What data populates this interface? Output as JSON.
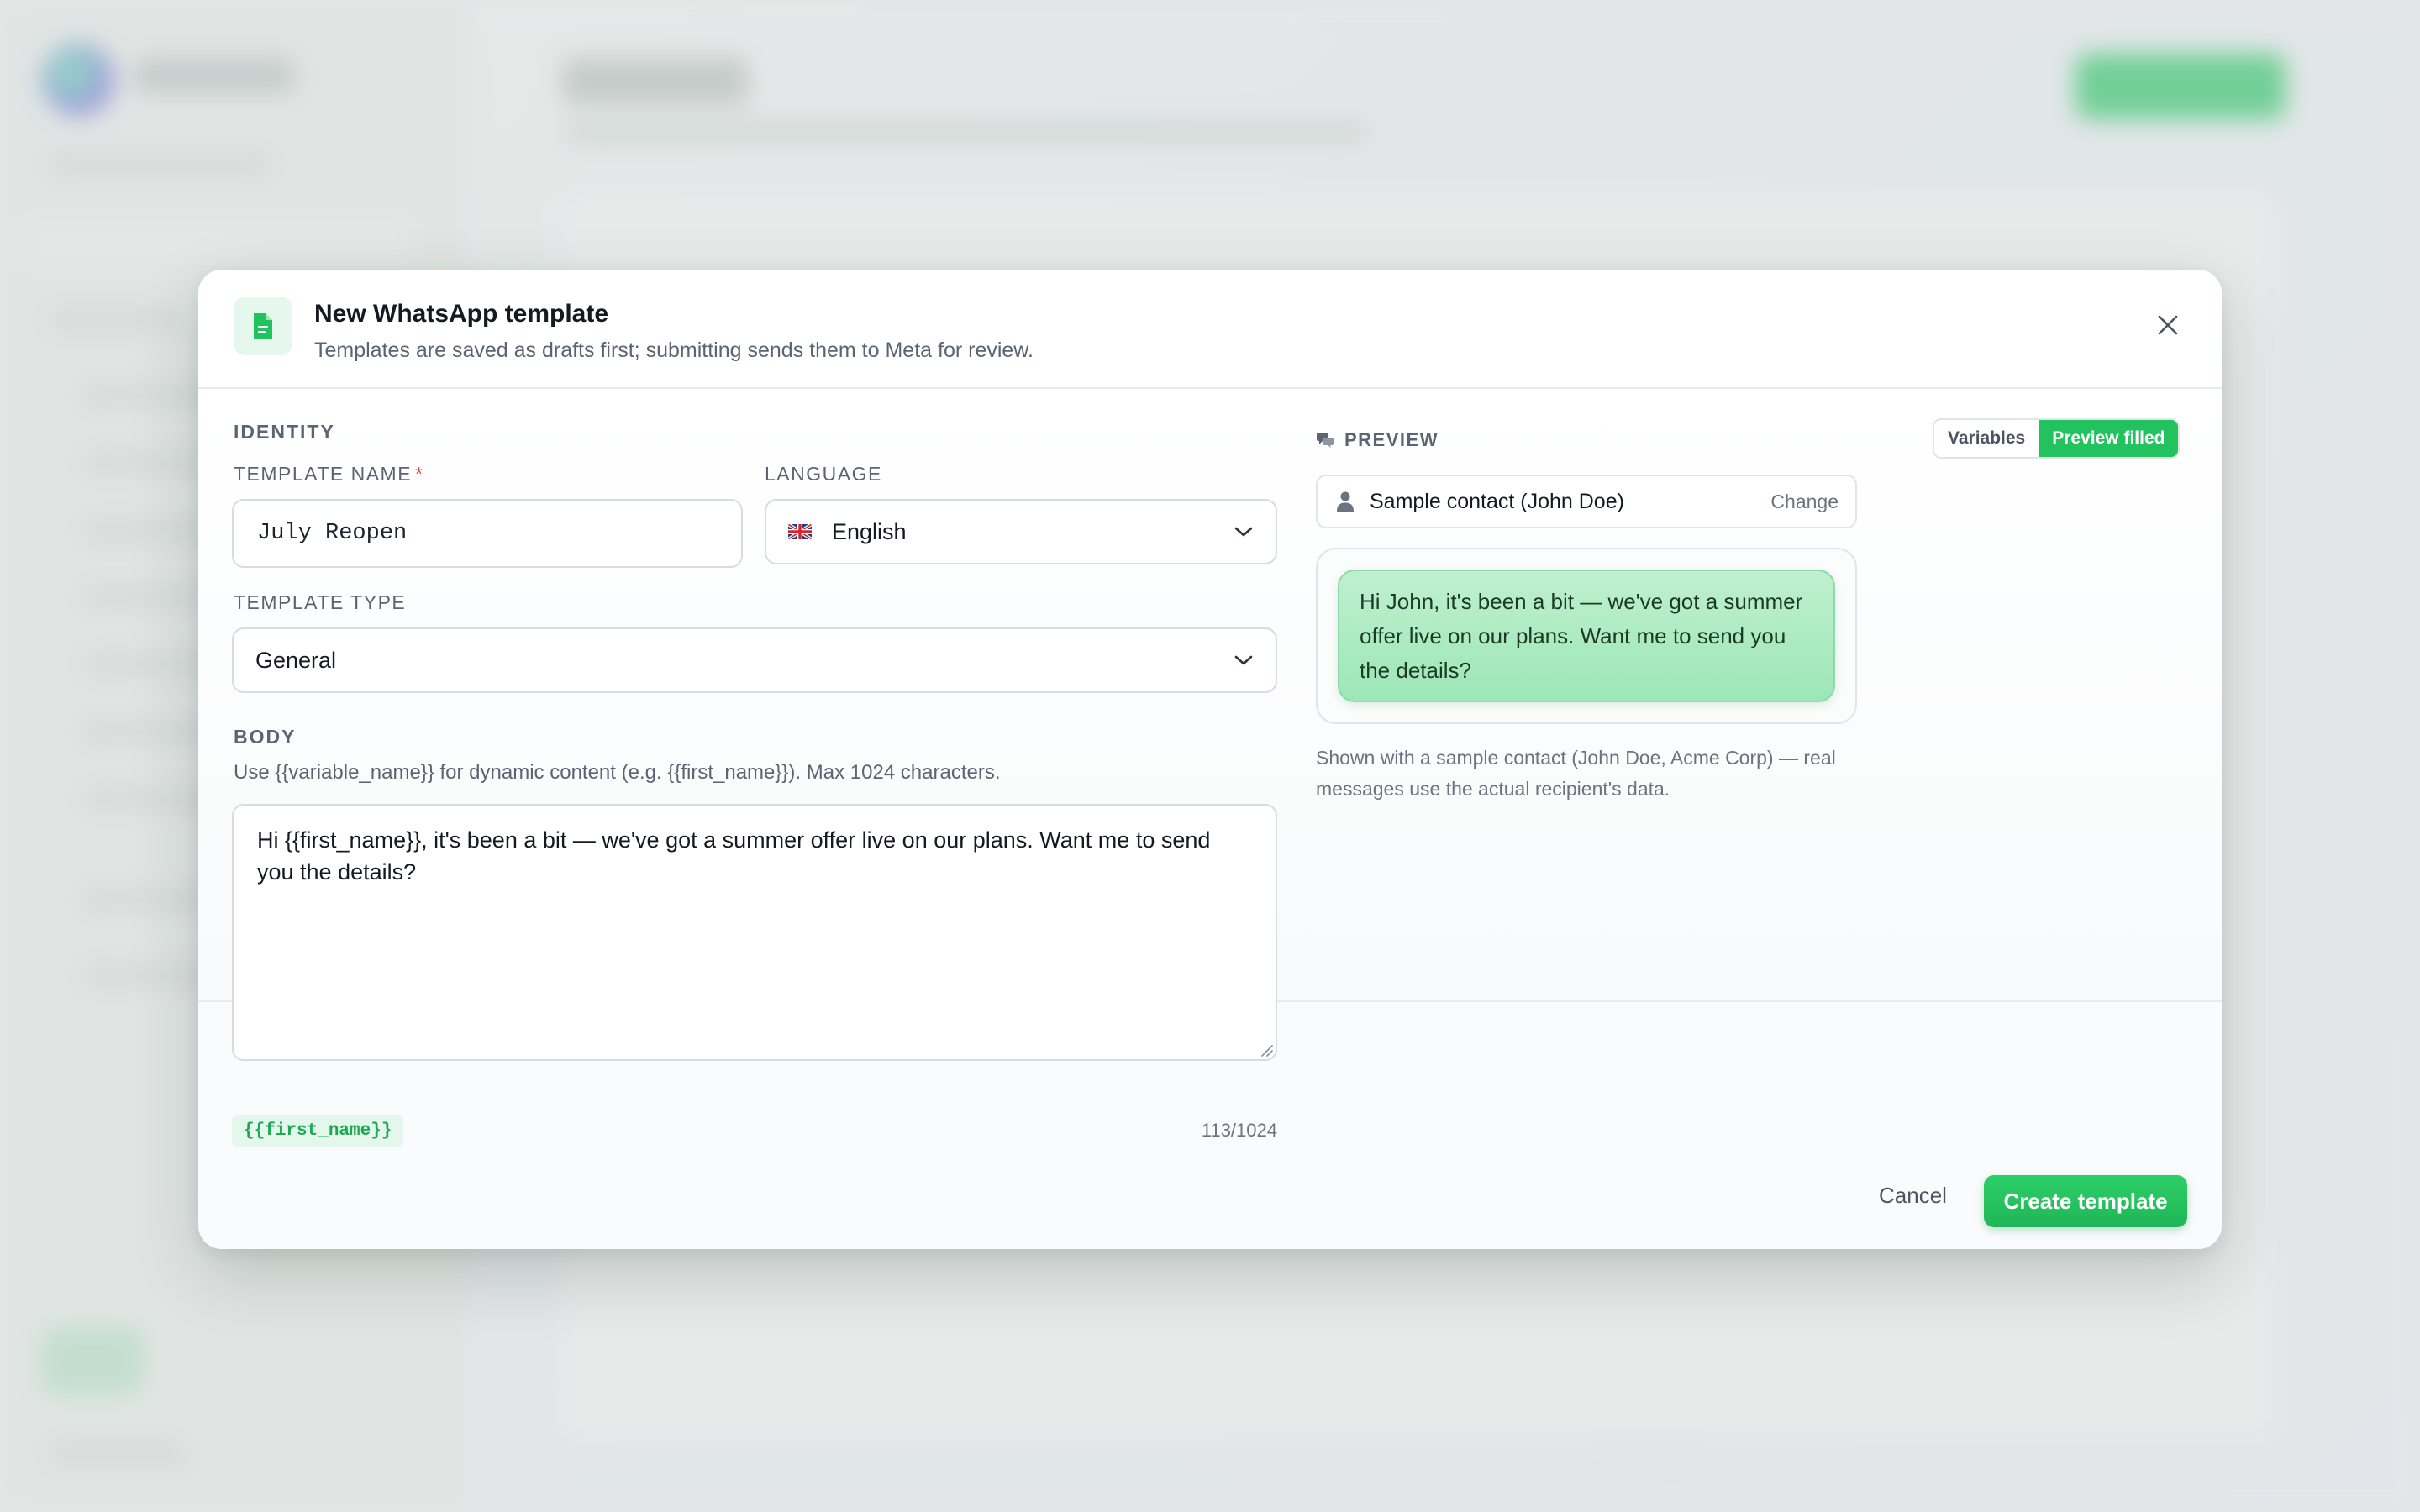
{
  "modal": {
    "title": "New WhatsApp template",
    "subtitle": "Templates are saved as drafts first; submitting sends them to Meta for review.",
    "icon": "document-icon",
    "close_icon": "close-icon"
  },
  "identity": {
    "section_label": "IDENTITY",
    "template_name_label": "TEMPLATE NAME",
    "required_marker": "*",
    "template_name_value": "July Reopen",
    "language_label": "LANGUAGE",
    "language_value": "English",
    "language_flag": "uk-flag-icon",
    "template_type_label": "TEMPLATE TYPE",
    "template_type_value": "General"
  },
  "body": {
    "section_label": "BODY",
    "helper": "Use {{variable_name}} for dynamic content (e.g. {{first_name}}). Max 1024 characters.",
    "value": "Hi {{first_name}}, it's been a bit — we've got a summer offer live on our plans. Want me to send you the details?",
    "variable_chip": "{{first_name}}",
    "char_count": "113/1024"
  },
  "preview": {
    "label": "PREVIEW",
    "toggle_variables": "Variables",
    "toggle_filled": "Preview filled",
    "active_toggle": "Preview filled",
    "contact_name": "Sample contact (John Doe)",
    "contact_change": "Change",
    "message": "Hi John, it's been a bit — we've got a summer offer live on our plans. Want me to send you the details?",
    "note": "Shown with a sample contact (John Doe, Acme Corp) — real messages use the actual recipient's data."
  },
  "footer": {
    "cancel_label": "Cancel",
    "create_label": "Create template"
  },
  "colors": {
    "accent": "#22c35e",
    "bubble": "#bff0cf",
    "required": "#e2453c"
  }
}
